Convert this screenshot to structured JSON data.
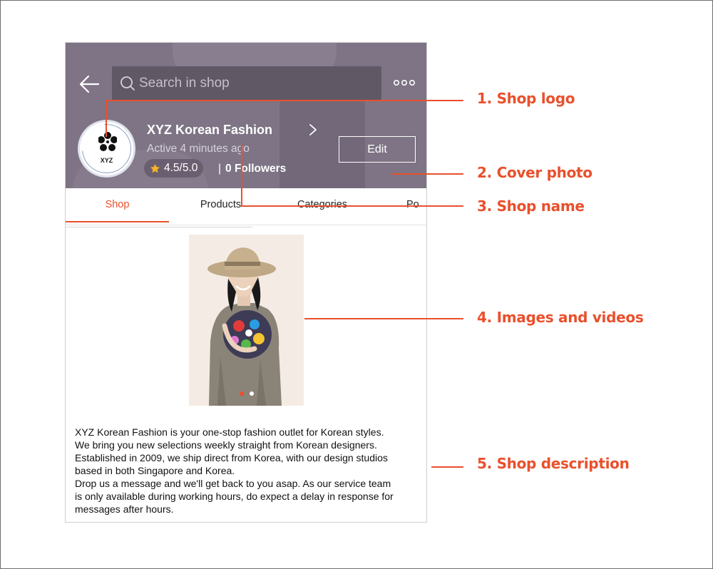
{
  "header": {
    "search_placeholder": "Search in shop"
  },
  "shop": {
    "logo_text": "XYZ",
    "name": "XYZ Korean Fashion",
    "active_status": "Active 4 minutes ago",
    "rating": "4.5/5.0",
    "followers_separator": "|",
    "followers": "0 Followers",
    "edit_label": "Edit"
  },
  "tabs": [
    {
      "label": "Shop",
      "active": true
    },
    {
      "label": "Products",
      "active": false
    },
    {
      "label": "Categories",
      "active": false
    },
    {
      "label": "Po",
      "active": false
    }
  ],
  "media": {
    "slides_total": 2,
    "current_slide": 1
  },
  "description": [
    "XYZ Korean Fashion is your one-stop fashion outlet for Korean styles.",
    "We bring you new selections weekly straight from Korean designers.",
    "Established in 2009, we ship direct from Korea, with our design studios",
    "based in both Singapore and Korea.",
    "Drop us a message and we'll get back to you asap. As our service team",
    "is only available during working hours, do expect a delay in response for",
    "messages after hours."
  ],
  "annotations": [
    {
      "label": "1. Shop logo"
    },
    {
      "label": "2. Cover photo"
    },
    {
      "label": "3. Shop name"
    },
    {
      "label": "4. Images and videos"
    },
    {
      "label": "5. Shop description"
    }
  ],
  "colors": {
    "accent": "#e9502c",
    "cover": "#7e7485",
    "search_bg": "#615866",
    "star": "#f5b423"
  },
  "icons": {
    "back": "arrow-left-icon",
    "search": "search-icon",
    "more": "more-horizontal-icon",
    "chevron": "chevron-right-icon",
    "star": "star-icon",
    "logo": "flower-icon"
  }
}
